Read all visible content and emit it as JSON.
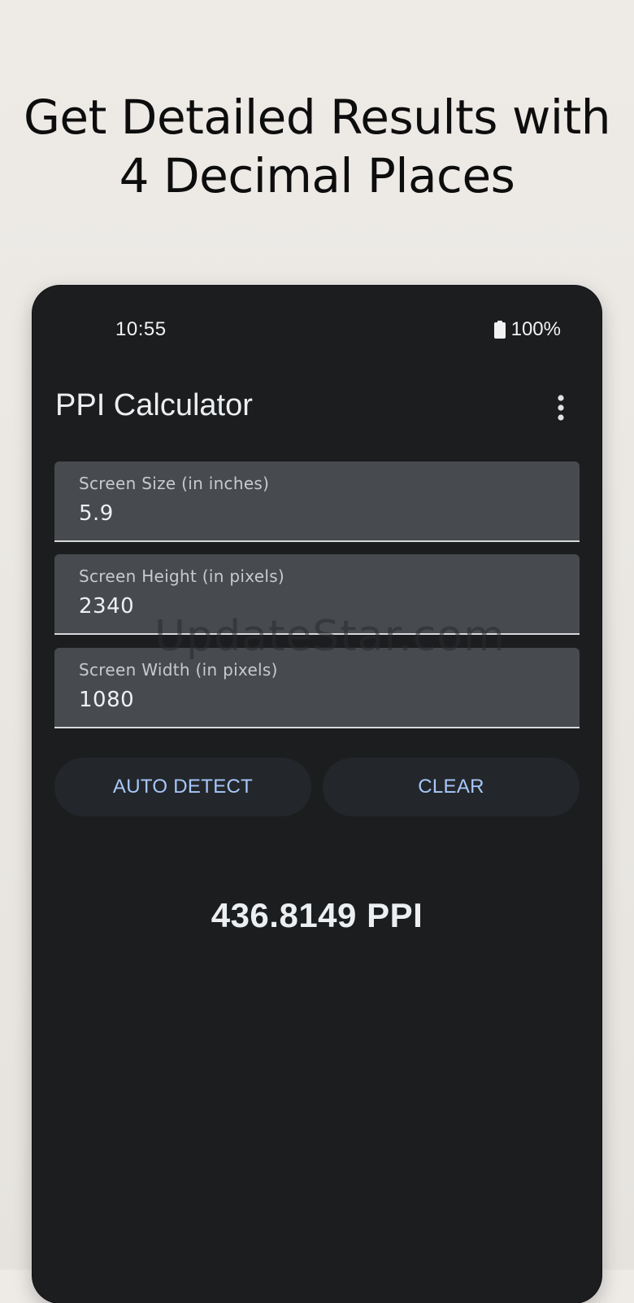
{
  "headline": {
    "line1": "Get Detailed Results with",
    "line2": "4 Decimal Places"
  },
  "status_bar": {
    "time": "10:55",
    "battery": "100%",
    "battery_icon": "battery-full-icon"
  },
  "app_bar": {
    "title": "PPI Calculator",
    "menu_icon": "more-vertical-icon"
  },
  "fields": [
    {
      "label": "Screen Size (in inches)",
      "value": "5.9"
    },
    {
      "label": "Screen Height (in pixels)",
      "value": "2340"
    },
    {
      "label": "Screen Width (in pixels)",
      "value": "1080"
    }
  ],
  "buttons": {
    "auto_detect": "AUTO DETECT",
    "clear": "CLEAR"
  },
  "result": "436.8149 PPI",
  "watermark": "UpdateStar.com",
  "colors": {
    "background": "#ebe8e4",
    "phone_bg": "#1c1d1f",
    "field_bg": "#474a4f",
    "button_bg": "#23272b",
    "accent_text": "#a8c7fa",
    "primary_text": "#eceff1"
  }
}
